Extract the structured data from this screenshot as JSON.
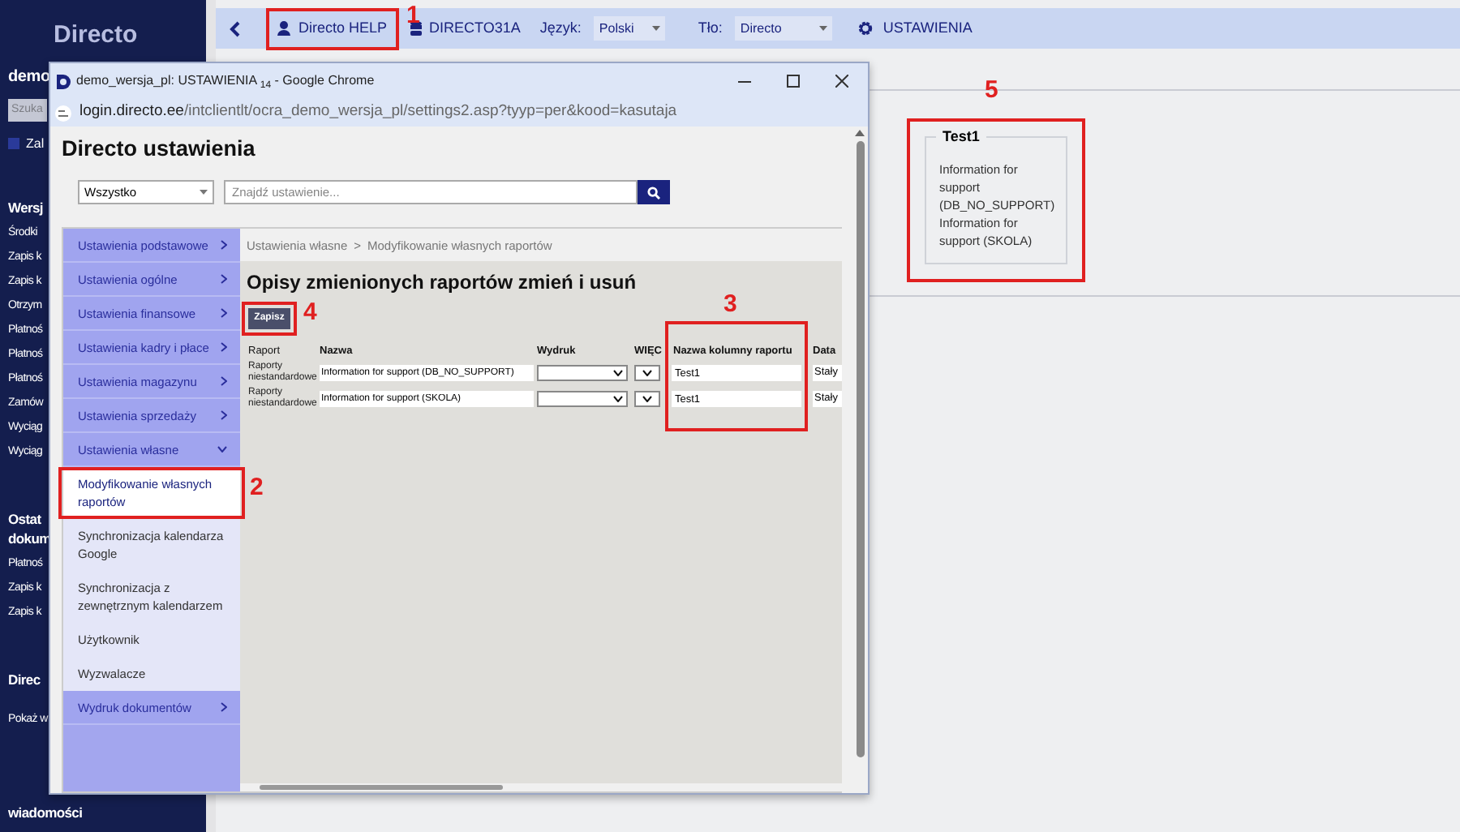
{
  "app": {
    "logo": "Directo",
    "company": "demo",
    "search_placeholder": "Szuka",
    "sidebar_link": "Zal",
    "sections": [
      {
        "title": "Wersj",
        "items": [
          "Środki",
          "Zapis k",
          "Zapis k",
          "Otrzym",
          "Płatnoś",
          "Płatnoś",
          "Płatnoś",
          "Zamów",
          "Wyciąg",
          "Wyciąg"
        ]
      },
      {
        "title": "Ostat dokum",
        "items": [
          "Płatnoś",
          "Zapis k",
          "Zapis k"
        ]
      },
      {
        "title": "Direc",
        "items": [
          "Pokaż w"
        ]
      },
      {
        "title": "wiadomości"
      }
    ]
  },
  "topbar": {
    "user": "Directo HELP",
    "database": "DIRECTO31A",
    "language_label": "Język:",
    "language": "Polski",
    "background_label": "Tło:",
    "background": "Directo",
    "settings": "USTAWIENIA"
  },
  "card": {
    "legend": "Test1",
    "lines": [
      "Information for support (DB_NO_SUPPORT)",
      "Information for support (SKOLA)"
    ]
  },
  "popup": {
    "title": "demo_wersja_pl: USTAWIENIA $_{14}$ - Google Chrome",
    "url_domain": "login.directo.ee",
    "url_path": "/intclientlt/ocra_demo_wersja_pl/settings2.asp?tyyp=per&kood=kasutaja",
    "heading": "Directo ustawienia",
    "filter": "Wszystko",
    "search_placeholder": "Znajdź ustawienie...",
    "menu": [
      {
        "kind": "group",
        "label": "Ustawienia podstawowe",
        "expanded": false
      },
      {
        "kind": "group",
        "label": "Ustawienia ogólne",
        "expanded": false
      },
      {
        "kind": "group",
        "label": "Ustawienia finansowe",
        "expanded": false
      },
      {
        "kind": "group",
        "label": "Ustawienia kadry i płace",
        "expanded": false
      },
      {
        "kind": "group",
        "label": "Ustawienia magazynu",
        "expanded": false
      },
      {
        "kind": "group",
        "label": "Ustawienia sprzedaży",
        "expanded": false
      },
      {
        "kind": "group",
        "label": "Ustawienia własne",
        "expanded": true
      },
      {
        "kind": "sub",
        "label": "Modyfikowanie własnych raportów",
        "selected": true
      },
      {
        "kind": "sub",
        "label": "Synchronizacja kalendarza Google",
        "selected": false
      },
      {
        "kind": "sub",
        "label": "Synchronizacja z zewnętrznym kalendarzem",
        "selected": false
      },
      {
        "kind": "sub",
        "label": "Użytkownik",
        "selected": false
      },
      {
        "kind": "sub",
        "label": "Wyzwalacze",
        "selected": false
      },
      {
        "kind": "group",
        "label": "Wydruk dokumentów",
        "expanded": false
      }
    ],
    "breadcrumb": [
      "Ustawienia własne",
      "Modyfikowanie własnych raportów"
    ],
    "breadcrumb_separator": ">",
    "page_title": "Opisy zmienionych raportów zmień i usuń",
    "save_button": "Zapisz",
    "table": {
      "columns": [
        "Raport",
        "Nazwa",
        "Wydruk",
        "WIĘC",
        "Nazwa kolumny raportu",
        "Data"
      ],
      "rows": [
        {
          "raport": "Raporty niestandardowe",
          "nazwa": "Information for support (DB_NO_SUPPORT)",
          "kolumna": "Test1",
          "data": "Stały"
        },
        {
          "raport": "Raporty niestandardowe",
          "nazwa": "Information for support (SKOLA)",
          "kolumna": "Test1",
          "data": "Stały"
        }
      ]
    }
  },
  "annotations": [
    {
      "label": "1",
      "color": "#e02020"
    },
    {
      "label": "2",
      "color": "#e02020"
    },
    {
      "label": "3",
      "color": "#e02020"
    },
    {
      "label": "4",
      "color": "#e02020"
    },
    {
      "label": "5",
      "color": "#e02020"
    }
  ]
}
